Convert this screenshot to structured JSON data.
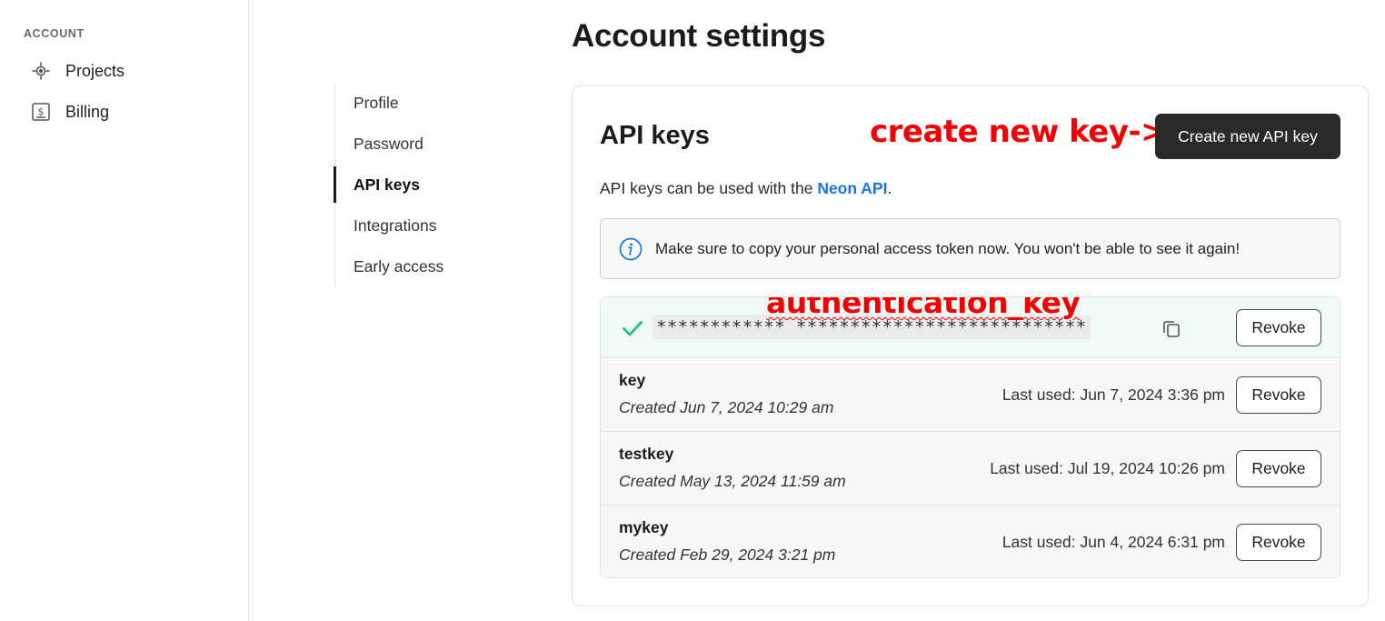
{
  "sidebar": {
    "section_label": "ACCOUNT",
    "items": [
      {
        "label": "Projects",
        "icon": "projects-icon"
      },
      {
        "label": "Billing",
        "icon": "billing-icon"
      }
    ]
  },
  "page_title": "Account settings",
  "subnav": {
    "items": [
      {
        "label": "Profile"
      },
      {
        "label": "Password"
      },
      {
        "label": "API keys",
        "active": true
      },
      {
        "label": "Integrations"
      },
      {
        "label": "Early access"
      }
    ]
  },
  "card": {
    "title": "API keys",
    "create_button": "Create new API key",
    "description_prefix": "API keys can be used with the ",
    "description_link": "Neon API",
    "description_suffix": ".",
    "info_message": "Make sure to copy your personal access token now. You won't be able to see it again!"
  },
  "annotations": {
    "create": "create new key->",
    "auth": "authentication_key"
  },
  "new_key": {
    "masked_value": "************ ***************************",
    "revoke_label": "Revoke"
  },
  "keys": [
    {
      "name": "key",
      "created": "Created Jun 7, 2024 10:29 am",
      "last_used": "Last used: Jun 7, 2024 3:36 pm",
      "revoke_label": "Revoke"
    },
    {
      "name": "testkey",
      "created": "Created May 13, 2024 11:59 am",
      "last_used": "Last used: Jul 19, 2024 10:26 pm",
      "revoke_label": "Revoke"
    },
    {
      "name": "mykey",
      "created": "Created Feb 29, 2024 3:21 pm",
      "last_used": "Last used: Jun 4, 2024 6:31 pm",
      "revoke_label": "Revoke"
    }
  ],
  "colors": {
    "accent_link": "#1a73e8",
    "annotation_red": "#f20000",
    "success_green": "#1fbf8a",
    "primary_button": "#2a2a2a"
  }
}
